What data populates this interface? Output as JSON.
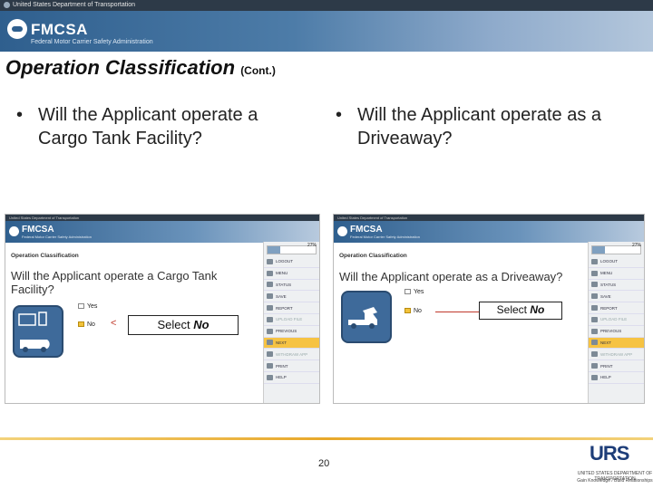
{
  "header": {
    "agency": "United States Department of Transportation",
    "brand": "FMCSA",
    "tagline": "Federal Motor Carrier Safety Administration"
  },
  "slide": {
    "title": "Operation Classification",
    "title_suffix": "(Cont.)",
    "page_number": "20"
  },
  "bullets": [
    {
      "text": "Will the Applicant operate a\nCargo Tank Facility?"
    },
    {
      "text": "Will the Applicant operate as a\nDriveaway?"
    }
  ],
  "screens": [
    {
      "section": "Operation Classification",
      "question": "Will the Applicant operate a Cargo Tank Facility?",
      "yes": "Yes",
      "no": "No",
      "callout_prefix": "Select",
      "callout_value": "No"
    },
    {
      "section": "Operation Classification",
      "question": "Will the Applicant operate as a Driveaway?",
      "yes": "Yes",
      "no": "No",
      "callout_prefix": "Select",
      "callout_value": "No"
    }
  ],
  "sidebar": {
    "progress": "27%",
    "items": [
      "LOGOUT",
      "MENU",
      "STATUS",
      "SAVE",
      "REPORT",
      "UPLOAD FILE",
      "PREVIOUS",
      "NEXT",
      "WITHDRAW APP",
      "PRINT",
      "HELP"
    ]
  },
  "footer": {
    "logo": "URS",
    "line1": "UNITED STATES DEPARTMENT OF TRANSPORTATION",
    "line2": "Gain Knowledge / Build Relationships"
  }
}
